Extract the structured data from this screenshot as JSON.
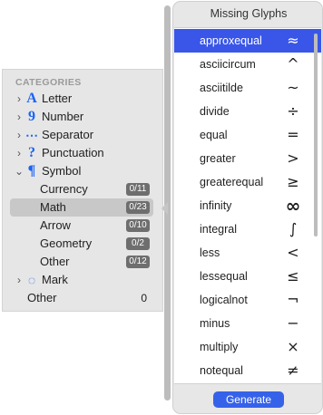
{
  "categories": {
    "header": "CATEGORIES",
    "items": [
      {
        "chevron": "›",
        "icon": "A",
        "label": "Letter"
      },
      {
        "chevron": "›",
        "icon": "9",
        "label": "Number"
      },
      {
        "chevron": "›",
        "icon": "⋯",
        "label": "Separator"
      },
      {
        "chevron": "›",
        "icon": "?",
        "label": "Punctuation"
      },
      {
        "chevron": "⌄",
        "icon": "¶",
        "label": "Symbol"
      }
    ],
    "symbol_children": [
      {
        "label": "Currency",
        "count": "0/11"
      },
      {
        "label": "Math",
        "count": "0/23"
      },
      {
        "label": "Arrow",
        "count": "0/10"
      },
      {
        "label": "Geometry",
        "count": "0/2"
      },
      {
        "label": "Other",
        "count": "0/12"
      }
    ],
    "mark": {
      "chevron": "›",
      "icon": "◌",
      "label": "Mark"
    },
    "other": {
      "label": "Other",
      "count": "0"
    }
  },
  "popover": {
    "title": "Missing Glyphs",
    "glyphs": [
      {
        "name": "approxequal",
        "char": "≈"
      },
      {
        "name": "asciicircum",
        "char": "^"
      },
      {
        "name": "asciitilde",
        "char": "~"
      },
      {
        "name": "divide",
        "char": "÷"
      },
      {
        "name": "equal",
        "char": "="
      },
      {
        "name": "greater",
        "char": ">"
      },
      {
        "name": "greaterequal",
        "char": "≥"
      },
      {
        "name": "infinity",
        "char": "∞"
      },
      {
        "name": "integral",
        "char": "∫"
      },
      {
        "name": "less",
        "char": "<"
      },
      {
        "name": "lessequal",
        "char": "≤"
      },
      {
        "name": "logicalnot",
        "char": "¬"
      },
      {
        "name": "minus",
        "char": "−"
      },
      {
        "name": "multiply",
        "char": "×"
      },
      {
        "name": "notequal",
        "char": "≠"
      }
    ],
    "button": "Generate"
  },
  "colors": {
    "accent": "#3a56e8",
    "icon_blue": "#1b64f2",
    "badge": "#6e6e6e"
  }
}
